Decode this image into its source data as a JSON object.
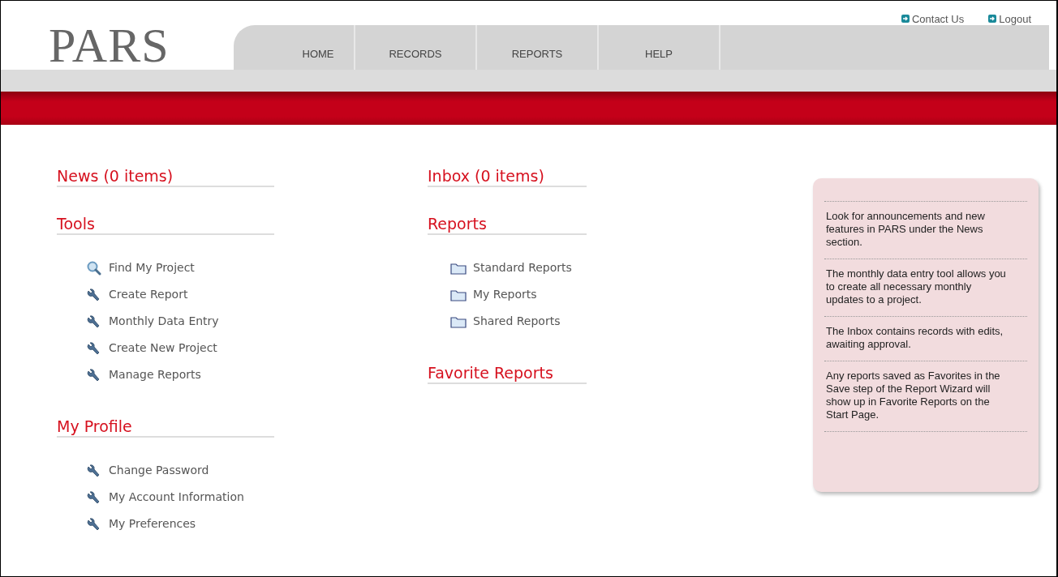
{
  "top_links": [
    {
      "label": "Contact Us"
    },
    {
      "label": "Logout"
    }
  ],
  "logo": "PARS",
  "nav": [
    {
      "label": "HOME"
    },
    {
      "label": "RECORDS"
    },
    {
      "label": "REPORTS"
    },
    {
      "label": "HELP"
    }
  ],
  "columns": [
    {
      "sections": [
        {
          "title": "News (0 items)"
        },
        {
          "title": "Tools",
          "items": [
            {
              "label": "Find My Project",
              "kind": "search"
            },
            {
              "label": "Create Report",
              "kind": "wrench"
            },
            {
              "label": "Monthly Data Entry",
              "kind": "wrench"
            },
            {
              "label": "Create New Project",
              "kind": "wrench"
            },
            {
              "label": "Manage Reports",
              "kind": "wrench"
            }
          ]
        },
        {
          "title": "My Profile",
          "items": [
            {
              "label": "Change Password",
              "kind": "wrench"
            },
            {
              "label": "My Account Information",
              "kind": "wrench"
            },
            {
              "label": "My Preferences",
              "kind": "wrench"
            }
          ]
        }
      ]
    },
    {
      "sections": [
        {
          "title": "Inbox (0 items)"
        },
        {
          "title": "Reports",
          "items": [
            {
              "label": "Standard Reports",
              "kind": "folder"
            },
            {
              "label": "My Reports",
              "kind": "folder"
            },
            {
              "label": "Shared Reports",
              "kind": "folder"
            }
          ]
        },
        {
          "title": "Favorite Reports"
        }
      ]
    }
  ],
  "tips": [
    "Look for announcements and new features in PARS under the News section.",
    "The monthly data entry tool allows you to create all necessary monthly updates to a project.",
    "The Inbox contains records with edits, awaiting approval.",
    "Any reports saved as Favorites in the Save step of the Report Wizard will show up in Favorite Reports on the Start Page."
  ]
}
